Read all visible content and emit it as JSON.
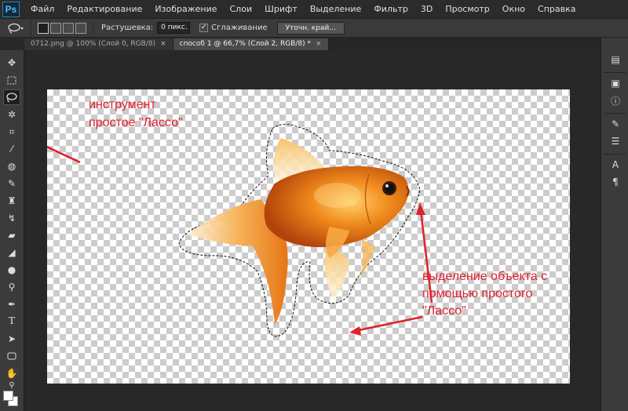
{
  "app": {
    "logo": "Ps"
  },
  "menu": [
    "Файл",
    "Редактирование",
    "Изображение",
    "Слои",
    "Шрифт",
    "Выделение",
    "Фильтр",
    "3D",
    "Просмотр",
    "Окно",
    "Справка"
  ],
  "options": {
    "feather_label": "Растушевка:",
    "feather_value": "0 пикс.",
    "antialias_label": "Сглаживание",
    "antialias_checked": "✓",
    "refine_label": "Уточн. край..."
  },
  "tabs": [
    {
      "label": "0712.png @ 100% (Слой 0, RGB/8)",
      "close": "×"
    },
    {
      "label": "способ 1 @ 66,7% (Слой 2, RGB/8) *",
      "close": "×"
    }
  ],
  "annotations": {
    "tool_line1": "инструмент",
    "tool_line2": "простое \"Лассо\"",
    "sel_line1": "выделение объекта с",
    "sel_line2": "помощью простого",
    "sel_line3": "\"Лассо\""
  },
  "icons": {
    "lasso": "lasso-icon",
    "move": "move-icon",
    "marquee": "marquee-icon",
    "magic_wand": "magic-wand-icon",
    "crop": "crop-icon",
    "eyedropper": "eyedropper-icon",
    "healing": "healing-brush-icon",
    "brush": "brush-icon",
    "stamp": "clone-stamp-icon",
    "history_brush": "history-brush-icon",
    "eraser": "eraser-icon",
    "blur": "blur-icon",
    "dodge": "dodge-icon",
    "pen": "pen-icon",
    "type": "type-icon",
    "path_select": "path-selection-icon",
    "shape": "shape-icon",
    "hand": "hand-icon",
    "zoom": "zoom-icon"
  },
  "colors": {
    "accent_annotation": "#e0202a"
  }
}
